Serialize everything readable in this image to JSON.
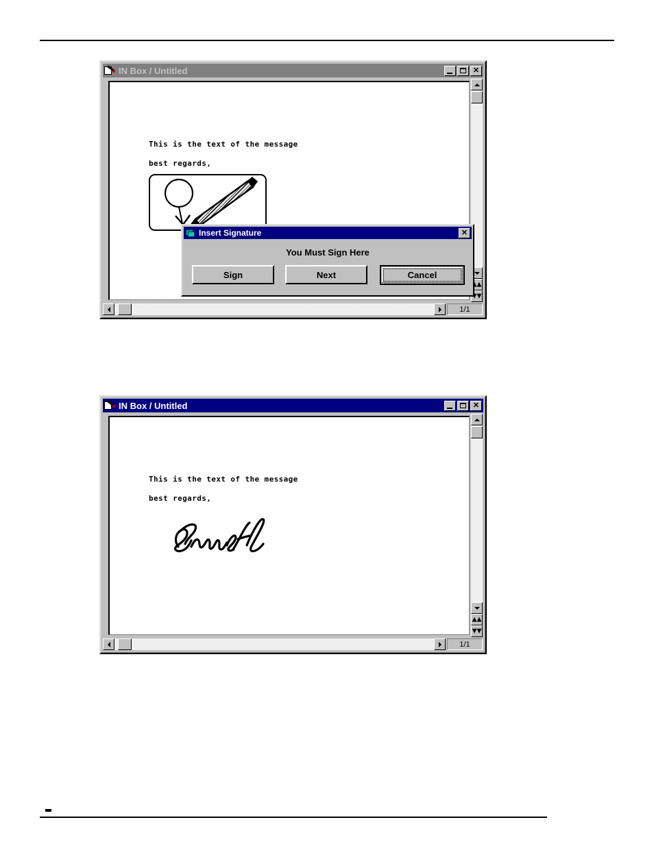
{
  "page": {
    "footer_mark": ""
  },
  "window_top": {
    "title": "IN Box / Untitled",
    "title_icon": "page-pen-icon",
    "active": false,
    "controls": {
      "minimize": "minimize-button",
      "maximize": "maximize-button",
      "close": "close-button"
    },
    "document": {
      "lines": [
        "This is the text of the message",
        "best regards,"
      ],
      "signature_state": "placeholder"
    },
    "status": "1/1"
  },
  "dialog": {
    "title": "Insert Signature",
    "title_icon": "signature-card-icon",
    "close_label": "✕",
    "message": "You Must Sign Here",
    "buttons": [
      {
        "label": "Sign",
        "default": false
      },
      {
        "label": "Next",
        "default": false
      },
      {
        "label": "Cancel",
        "default": true
      }
    ]
  },
  "window_bottom": {
    "title": "IN Box / Untitled",
    "title_icon": "page-pen-icon",
    "active": true,
    "controls": {
      "minimize": "minimize-button",
      "maximize": "maximize-button",
      "close": "close-button"
    },
    "document": {
      "lines": [
        "This is the text of the message",
        "best regards,"
      ],
      "signature_state": "signed"
    },
    "status": "1/1"
  },
  "colors": {
    "title_active": "#000080",
    "title_inactive": "#808080",
    "face": "#c0c0c0",
    "page": "#ffffff",
    "ink": "#000000"
  }
}
